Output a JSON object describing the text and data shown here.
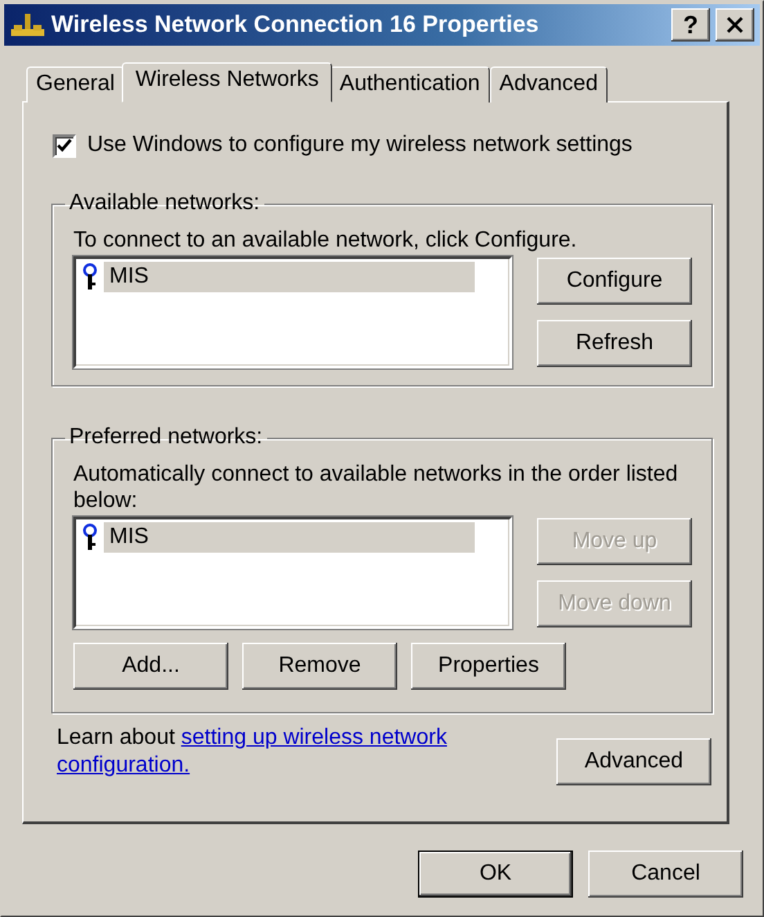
{
  "window": {
    "title": "Wireless Network Connection 16 Properties",
    "help_button": "?"
  },
  "tabs": [
    {
      "label": "General",
      "selected": false
    },
    {
      "label": "Wireless Networks",
      "selected": true
    },
    {
      "label": "Authentication",
      "selected": false
    },
    {
      "label": "Advanced",
      "selected": false
    }
  ],
  "use_windows_checkbox": {
    "label": "Use Windows to configure my wireless network settings",
    "checked": true
  },
  "available_networks": {
    "title": "Available networks:",
    "description": "To connect to an available network, click Configure.",
    "networks": [
      {
        "name": "MIS",
        "selected": true
      }
    ],
    "buttons": [
      {
        "label": "Configure",
        "disabled": false
      },
      {
        "label": "Refresh",
        "disabled": false
      }
    ]
  },
  "preferred_networks": {
    "title": "Preferred networks:",
    "description": "Automatically connect to available networks in the order listed below:",
    "networks": [
      {
        "name": "MIS",
        "selected": true
      }
    ],
    "buttons": [
      {
        "label": "Move up",
        "disabled": true
      },
      {
        "label": "Move down",
        "disabled": true
      }
    ],
    "bottom_buttons": [
      {
        "label": "Add...",
        "disabled": false
      },
      {
        "label": "Remove",
        "disabled": false
      },
      {
        "label": "Properties",
        "disabled": false
      }
    ]
  },
  "learn_more": {
    "text": "Learn about ",
    "link_lines": [
      "setting up wireless network",
      "configuration."
    ]
  },
  "advanced_button": {
    "label": "Advanced",
    "disabled": false
  },
  "dialog_buttons": [
    {
      "label": "OK",
      "default": true
    },
    {
      "label": "Cancel",
      "default": false
    }
  ]
}
